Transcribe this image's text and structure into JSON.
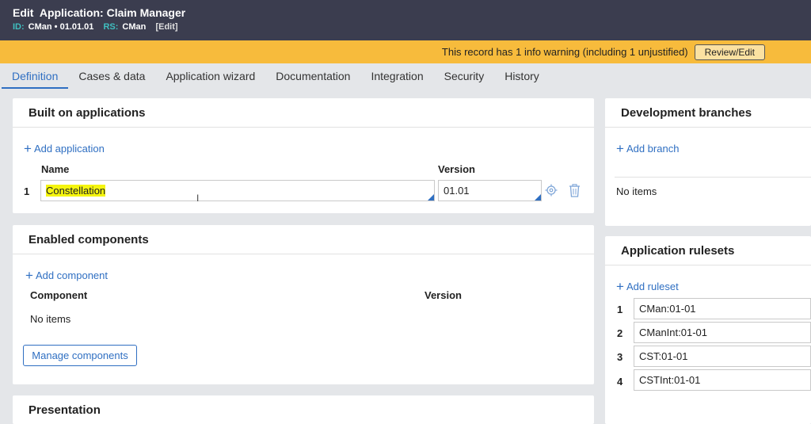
{
  "header": {
    "mode": "Edit",
    "title": "Application: Claim Manager",
    "id_label": "ID:",
    "id_value": "CMan • 01.01.01",
    "rs_label": "RS:",
    "rs_value": "CMan",
    "edit_link": "[Edit]"
  },
  "warning": {
    "text": "This record has 1 info warning (including 1 unjustified)",
    "button": "Review/Edit"
  },
  "tabs": [
    {
      "label": "Definition",
      "active": true
    },
    {
      "label": "Cases & data"
    },
    {
      "label": "Application wizard"
    },
    {
      "label": "Documentation"
    },
    {
      "label": "Integration"
    },
    {
      "label": "Security"
    },
    {
      "label": "History"
    }
  ],
  "built_on": {
    "title": "Built on applications",
    "add_label": "Add application",
    "col_name": "Name",
    "col_version": "Version",
    "rows": [
      {
        "num": "1",
        "name": "Constellation",
        "version": "01.01"
      }
    ]
  },
  "components": {
    "title": "Enabled components",
    "add_label": "Add component",
    "col_component": "Component",
    "col_version": "Version",
    "empty": "No items",
    "manage_button": "Manage components"
  },
  "presentation": {
    "title": "Presentation"
  },
  "branches": {
    "title": "Development branches",
    "add_label": "Add branch",
    "empty": "No items"
  },
  "rulesets": {
    "title": "Application rulesets",
    "add_label": "Add ruleset",
    "rows": [
      {
        "num": "1",
        "value": "CMan:01-01"
      },
      {
        "num": "2",
        "value": "CManInt:01-01"
      },
      {
        "num": "3",
        "value": "CST:01-01"
      },
      {
        "num": "4",
        "value": "CSTInt:01-01"
      }
    ]
  },
  "colors": {
    "header_bg": "#3b3d4f",
    "warning_bg": "#f7bb3c",
    "accent": "#2f6fc2",
    "highlight": "#f5f50f"
  },
  "icons": [
    "plus-icon",
    "target-icon",
    "trash-icon",
    "text-cursor-icon"
  ]
}
